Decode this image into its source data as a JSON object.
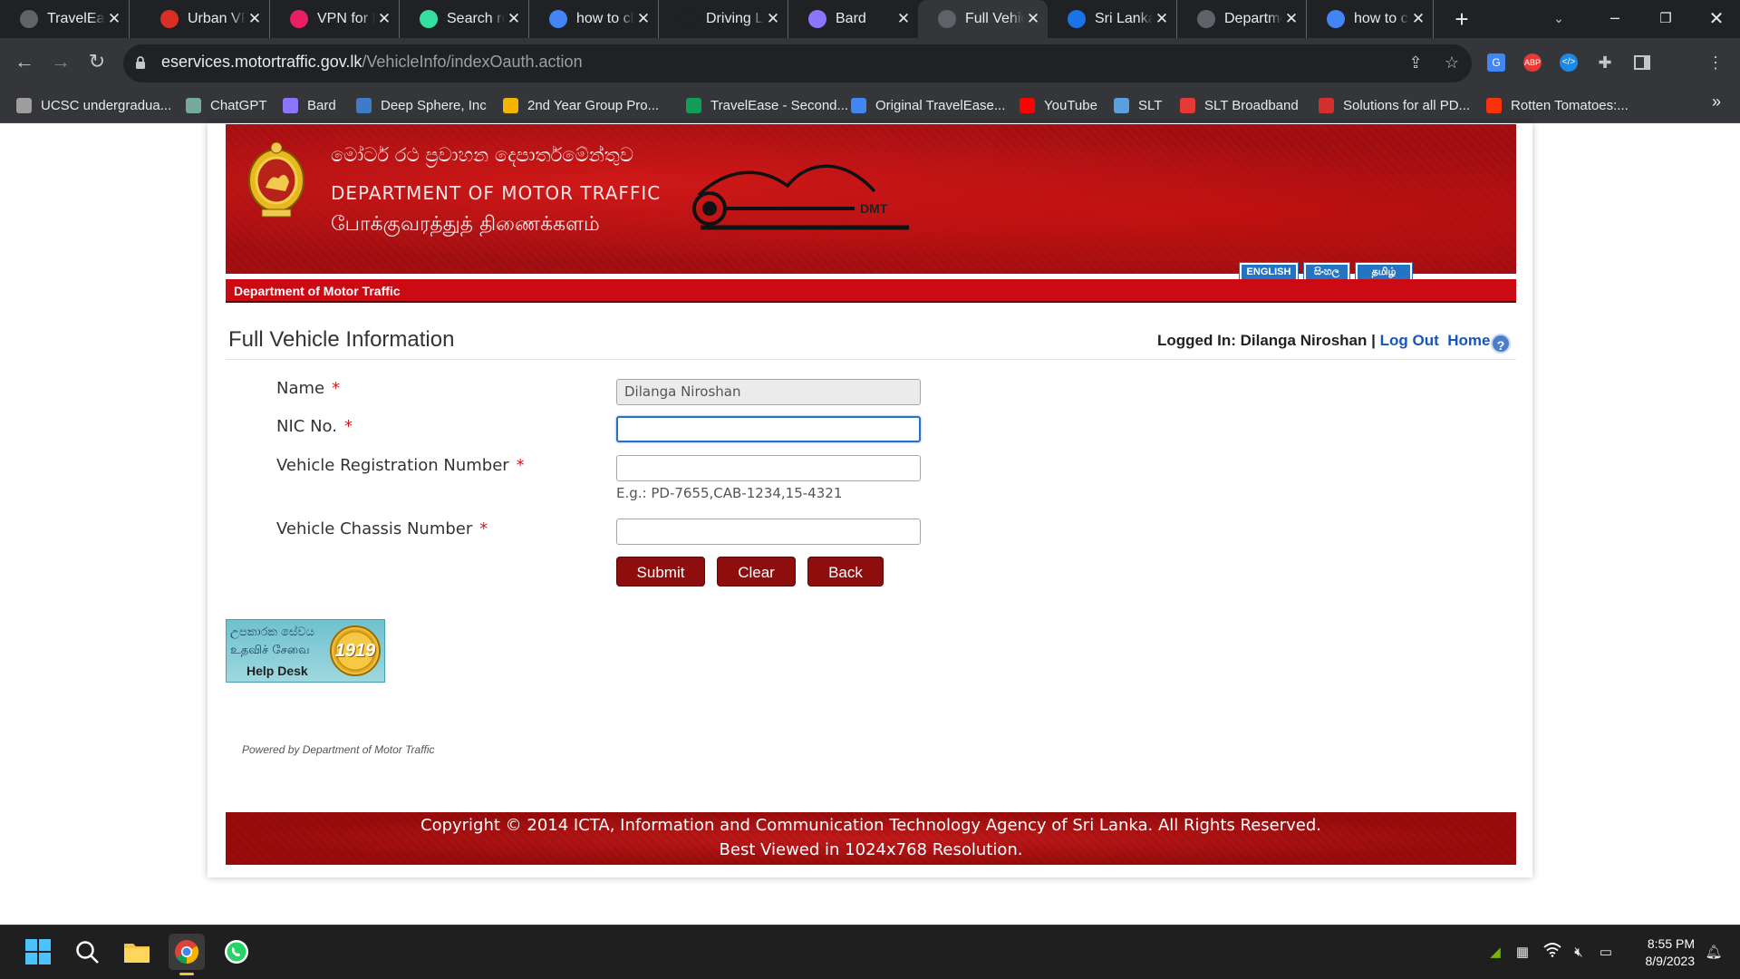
{
  "browser": {
    "tabs": [
      {
        "title": "TravelEase",
        "icon": "globe-icon",
        "color": "#5f6368"
      },
      {
        "title": "Urban VPN",
        "icon": "gmail-icon",
        "color": "#d93025"
      },
      {
        "title": "VPN for Desktop",
        "icon": "vpn-icon",
        "color": "#e91e63"
      },
      {
        "title": "Search results",
        "icon": "tripadvisor-icon",
        "color": "#34e0a1"
      },
      {
        "title": "how to check",
        "icon": "google-icon",
        "color": "#4285f4"
      },
      {
        "title": "Driving License",
        "icon": "blank-icon",
        "color": "#202124"
      },
      {
        "title": "Bard",
        "icon": "bard-icon",
        "color": "#8e75ff"
      },
      {
        "title": "Full Vehicle Information",
        "icon": "globe-icon",
        "color": "#5f6368"
      },
      {
        "title": "Sri Lanka",
        "icon": "globe-blue-icon",
        "color": "#1a73e8"
      },
      {
        "title": "Department",
        "icon": "globe-icon",
        "color": "#5f6368"
      },
      {
        "title": "how to check",
        "icon": "google-icon",
        "color": "#4285f4"
      }
    ],
    "new_tab_label": "+",
    "url_host": "eservices.motortraffic.gov.lk",
    "url_path": "/VehicleInfo/indexOauth.action",
    "bookmarks": [
      {
        "label": "UCSC undergradua...",
        "color": "#9e9e9e"
      },
      {
        "label": "ChatGPT",
        "color": "#74aa9c"
      },
      {
        "label": "Bard",
        "color": "#8e75ff"
      },
      {
        "label": "Deep Sphere, Inc",
        "color": "#3f7cc8"
      },
      {
        "label": "2nd Year Group Pro...",
        "color": "#f4b400"
      },
      {
        "label": "TravelEase - Second...",
        "color": "#0f9d58"
      },
      {
        "label": "Original TravelEase...",
        "color": "#4285f4"
      },
      {
        "label": "YouTube",
        "color": "#ff0000"
      },
      {
        "label": "SLT",
        "color": "#5aa0e0"
      },
      {
        "label": "SLT Broadband",
        "color": "#e53935"
      },
      {
        "label": "Solutions for all PD...",
        "color": "#d32f2f"
      },
      {
        "label": "Rotten Tomatoes:...",
        "color": "#fa320a"
      }
    ],
    "bookmarks_more": "»"
  },
  "header": {
    "sinhala_title": "මෝටර් රථ ප්‍රවාහන දෙපාර්තමේන්තුව",
    "english_title": "DEPARTMENT OF MOTOR TRAFFIC",
    "tamil_title": "போக்குவரத்துத் திணைக்களம்",
    "logo_text": "DMT",
    "languages": [
      "ENGLISH",
      "සිංහල",
      "தமிழ்"
    ]
  },
  "redbar_label": "Department of Motor Traffic",
  "page": {
    "title": "Full Vehicle Information",
    "logged_in_prefix": "Logged In: Dilanga Niroshan |",
    "logout_label": "Log Out",
    "home_label": "Home",
    "help_label": "?"
  },
  "form": {
    "name_label": "Name",
    "name_value": "Dilanga Niroshan",
    "nic_label": "NIC No.",
    "nic_value": "",
    "reg_label": "Vehicle Registration Number",
    "reg_value": "",
    "reg_hint": "E.g.: PD-7655,CAB-1234,15-4321",
    "chassis_label": "Vehicle Chassis Number",
    "chassis_value": "",
    "required_mark": "*",
    "submit_label": "Submit",
    "clear_label": "Clear",
    "back_label": "Back"
  },
  "helpdesk": {
    "sinhala": "උපකාරක සේවය",
    "tamil": "உதவிச் சேவை",
    "english": "Help Desk",
    "number": "1919"
  },
  "powered_by": "Powered by Department of Motor Traffic",
  "footer": {
    "line1": "Copyright © 2014 ICTA, Information and Communication Technology Agency of Sri Lanka. All Rights Reserved.",
    "line2": "Best Viewed in 1024x768 Resolution."
  },
  "taskbar": {
    "time": "8:55 PM",
    "date": "8/9/2023"
  }
}
